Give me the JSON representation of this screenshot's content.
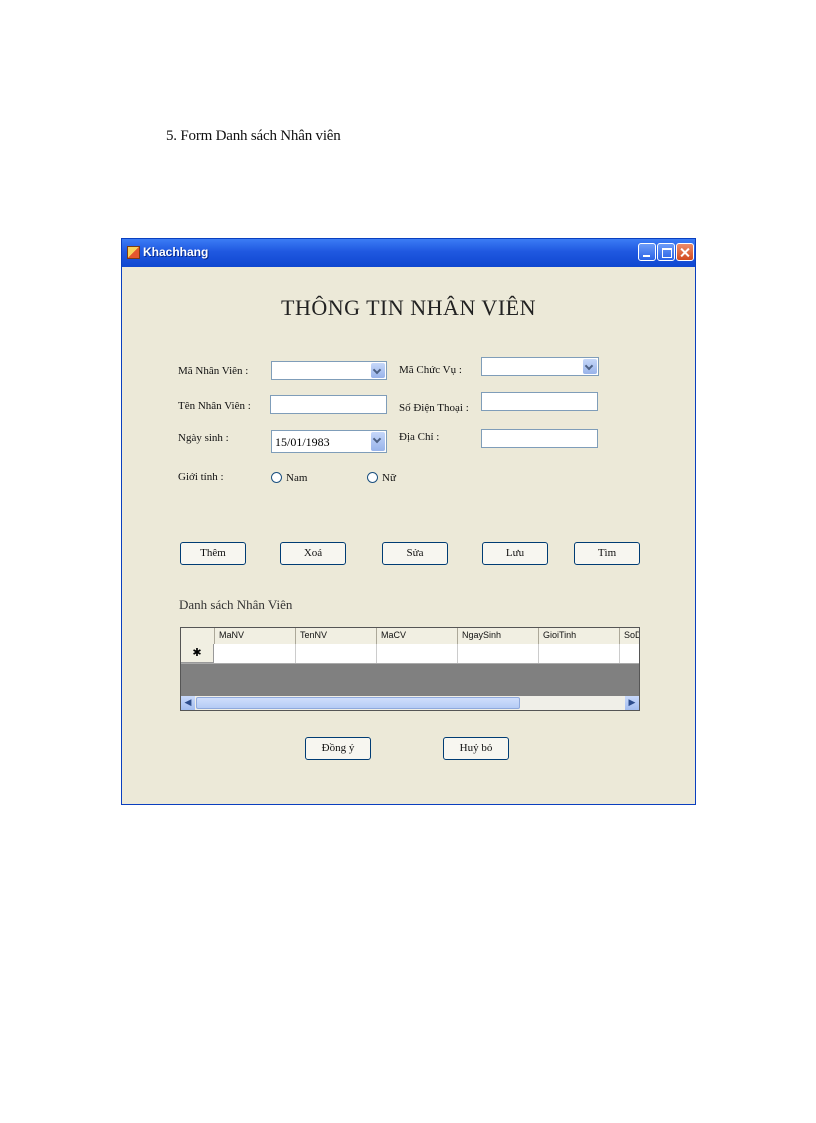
{
  "document": {
    "caption": "5. Form Danh sách Nhân viên"
  },
  "window": {
    "title": "Khachhang"
  },
  "form": {
    "heading": "THÔNG TIN NHÂN VIÊN",
    "labels": {
      "ma_nhan_vien": "Mã Nhân Viên :",
      "ten_nhan_vien": "Tên Nhân Viên :",
      "ngay_sinh": "Ngày sinh :",
      "gioi_tinh": "Giới tính :",
      "ma_chuc_vu": "Mã Chức Vụ :",
      "so_dien_thoai": "Số Điện Thoại :",
      "dia_chi": "Địa Chỉ :"
    },
    "values": {
      "ma_nhan_vien": "",
      "ten_nhan_vien": "",
      "ngay_sinh": "15/01/1983",
      "ma_chuc_vu": "",
      "so_dien_thoai": "",
      "dia_chi": ""
    },
    "gender_options": [
      "Nam",
      "Nữ"
    ],
    "buttons": [
      "Thêm",
      "Xoá",
      "Sửa",
      "Lưu",
      "Tìm"
    ]
  },
  "list": {
    "title": "Danh sách Nhân Viên",
    "columns": [
      "MaNV",
      "TenNV",
      "MaCV",
      "NgaySinh",
      "GioiTinh",
      "SoD"
    ],
    "new_row_marker": "✱"
  },
  "footer_buttons": {
    "ok": "Đồng ý",
    "cancel": "Huỷ bỏ"
  },
  "colors": {
    "titlebar": "#1f58e0",
    "window_bg": "#ece9d8",
    "grid_empty": "#808080"
  }
}
